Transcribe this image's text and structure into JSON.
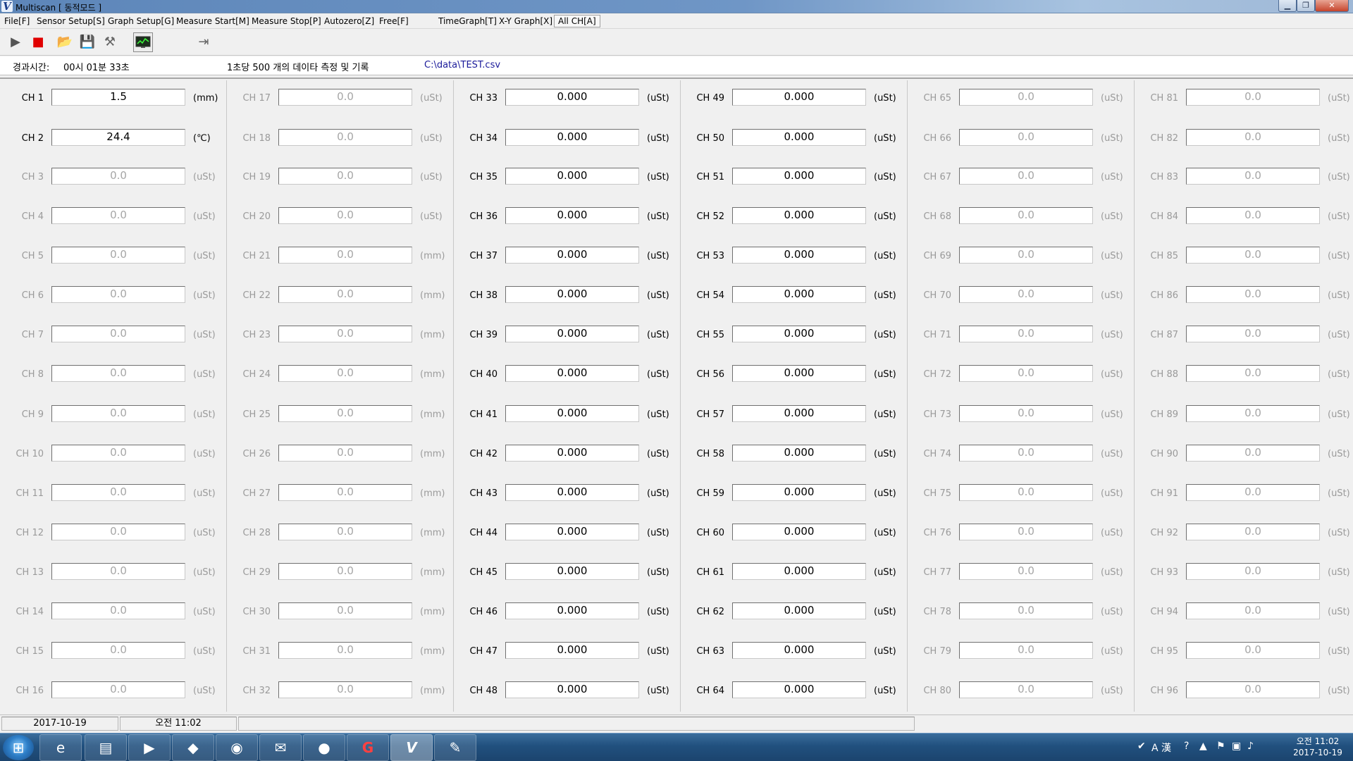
{
  "window": {
    "title": "Multiscan  [ 동적모드 ]"
  },
  "menu": [
    {
      "label": "File[F]",
      "disabled": true
    },
    {
      "label": "Sensor Setup[S]",
      "disabled": true
    },
    {
      "label": "Graph Setup[G]",
      "disabled": false
    },
    {
      "label": "Measure Start[M]",
      "disabled": true
    },
    {
      "label": "Measure Stop[P]",
      "disabled": false
    },
    {
      "label": "Autozero[Z]",
      "disabled": true
    },
    {
      "label": "Free[F]",
      "disabled": true
    },
    {
      "label": "TimeGraph[T]",
      "disabled": false
    },
    {
      "label": "X-Y Graph[X]",
      "disabled": true
    },
    {
      "label": "All CH[A]",
      "disabled": false
    }
  ],
  "toolbar": {
    "icons": [
      "play-icon",
      "stop-icon",
      "open-folder-icon",
      "save-icon",
      "tools-icon",
      "monitor-graph-icon",
      "exit-icon"
    ]
  },
  "info": {
    "elapsed_label": "경과시간:",
    "elapsed_value": "00시 01분 33초",
    "rate_text": "1초당 500 개의 데이타 측정 및 기록",
    "file_path": "C:\\data\\TEST.csv"
  },
  "columns": [
    {
      "channels": [
        {
          "label": "CH 1",
          "value": "1.5",
          "unit": "(mm)",
          "active": true
        },
        {
          "label": "CH 2",
          "value": "24.4",
          "unit": "(℃)",
          "active": true
        },
        {
          "label": "CH 3",
          "value": "0.0",
          "unit": "(uSt)",
          "active": false
        },
        {
          "label": "CH 4",
          "value": "0.0",
          "unit": "(uSt)",
          "active": false
        },
        {
          "label": "CH 5",
          "value": "0.0",
          "unit": "(uSt)",
          "active": false
        },
        {
          "label": "CH 6",
          "value": "0.0",
          "unit": "(uSt)",
          "active": false
        },
        {
          "label": "CH 7",
          "value": "0.0",
          "unit": "(uSt)",
          "active": false
        },
        {
          "label": "CH 8",
          "value": "0.0",
          "unit": "(uSt)",
          "active": false
        },
        {
          "label": "CH 9",
          "value": "0.0",
          "unit": "(uSt)",
          "active": false
        },
        {
          "label": "CH 10",
          "value": "0.0",
          "unit": "(uSt)",
          "active": false
        },
        {
          "label": "CH 11",
          "value": "0.0",
          "unit": "(uSt)",
          "active": false
        },
        {
          "label": "CH 12",
          "value": "0.0",
          "unit": "(uSt)",
          "active": false
        },
        {
          "label": "CH 13",
          "value": "0.0",
          "unit": "(uSt)",
          "active": false
        },
        {
          "label": "CH 14",
          "value": "0.0",
          "unit": "(uSt)",
          "active": false
        },
        {
          "label": "CH 15",
          "value": "0.0",
          "unit": "(uSt)",
          "active": false
        },
        {
          "label": "CH 16",
          "value": "0.0",
          "unit": "(uSt)",
          "active": false
        }
      ]
    },
    {
      "channels": [
        {
          "label": "CH 17",
          "value": "0.0",
          "unit": "(uSt)",
          "active": false
        },
        {
          "label": "CH 18",
          "value": "0.0",
          "unit": "(uSt)",
          "active": false
        },
        {
          "label": "CH 19",
          "value": "0.0",
          "unit": "(uSt)",
          "active": false
        },
        {
          "label": "CH 20",
          "value": "0.0",
          "unit": "(uSt)",
          "active": false
        },
        {
          "label": "CH 21",
          "value": "0.0",
          "unit": "(mm)",
          "active": false
        },
        {
          "label": "CH 22",
          "value": "0.0",
          "unit": "(mm)",
          "active": false
        },
        {
          "label": "CH 23",
          "value": "0.0",
          "unit": "(mm)",
          "active": false
        },
        {
          "label": "CH 24",
          "value": "0.0",
          "unit": "(mm)",
          "active": false
        },
        {
          "label": "CH 25",
          "value": "0.0",
          "unit": "(mm)",
          "active": false
        },
        {
          "label": "CH 26",
          "value": "0.0",
          "unit": "(mm)",
          "active": false
        },
        {
          "label": "CH 27",
          "value": "0.0",
          "unit": "(mm)",
          "active": false
        },
        {
          "label": "CH 28",
          "value": "0.0",
          "unit": "(mm)",
          "active": false
        },
        {
          "label": "CH 29",
          "value": "0.0",
          "unit": "(mm)",
          "active": false
        },
        {
          "label": "CH 30",
          "value": "0.0",
          "unit": "(mm)",
          "active": false
        },
        {
          "label": "CH 31",
          "value": "0.0",
          "unit": "(mm)",
          "active": false
        },
        {
          "label": "CH 32",
          "value": "0.0",
          "unit": "(mm)",
          "active": false
        }
      ]
    },
    {
      "channels": [
        {
          "label": "CH 33",
          "value": "0.000",
          "unit": "(uSt)",
          "active": true
        },
        {
          "label": "CH 34",
          "value": "0.000",
          "unit": "(uSt)",
          "active": true
        },
        {
          "label": "CH 35",
          "value": "0.000",
          "unit": "(uSt)",
          "active": true
        },
        {
          "label": "CH 36",
          "value": "0.000",
          "unit": "(uSt)",
          "active": true
        },
        {
          "label": "CH 37",
          "value": "0.000",
          "unit": "(uSt)",
          "active": true
        },
        {
          "label": "CH 38",
          "value": "0.000",
          "unit": "(uSt)",
          "active": true
        },
        {
          "label": "CH 39",
          "value": "0.000",
          "unit": "(uSt)",
          "active": true
        },
        {
          "label": "CH 40",
          "value": "0.000",
          "unit": "(uSt)",
          "active": true
        },
        {
          "label": "CH 41",
          "value": "0.000",
          "unit": "(uSt)",
          "active": true
        },
        {
          "label": "CH 42",
          "value": "0.000",
          "unit": "(uSt)",
          "active": true
        },
        {
          "label": "CH 43",
          "value": "0.000",
          "unit": "(uSt)",
          "active": true
        },
        {
          "label": "CH 44",
          "value": "0.000",
          "unit": "(uSt)",
          "active": true
        },
        {
          "label": "CH 45",
          "value": "0.000",
          "unit": "(uSt)",
          "active": true
        },
        {
          "label": "CH 46",
          "value": "0.000",
          "unit": "(uSt)",
          "active": true
        },
        {
          "label": "CH 47",
          "value": "0.000",
          "unit": "(uSt)",
          "active": true
        },
        {
          "label": "CH 48",
          "value": "0.000",
          "unit": "(uSt)",
          "active": true
        }
      ]
    },
    {
      "channels": [
        {
          "label": "CH 49",
          "value": "0.000",
          "unit": "(uSt)",
          "active": true
        },
        {
          "label": "CH 50",
          "value": "0.000",
          "unit": "(uSt)",
          "active": true
        },
        {
          "label": "CH 51",
          "value": "0.000",
          "unit": "(uSt)",
          "active": true
        },
        {
          "label": "CH 52",
          "value": "0.000",
          "unit": "(uSt)",
          "active": true
        },
        {
          "label": "CH 53",
          "value": "0.000",
          "unit": "(uSt)",
          "active": true
        },
        {
          "label": "CH 54",
          "value": "0.000",
          "unit": "(uSt)",
          "active": true
        },
        {
          "label": "CH 55",
          "value": "0.000",
          "unit": "(uSt)",
          "active": true
        },
        {
          "label": "CH 56",
          "value": "0.000",
          "unit": "(uSt)",
          "active": true
        },
        {
          "label": "CH 57",
          "value": "0.000",
          "unit": "(uSt)",
          "active": true
        },
        {
          "label": "CH 58",
          "value": "0.000",
          "unit": "(uSt)",
          "active": true
        },
        {
          "label": "CH 59",
          "value": "0.000",
          "unit": "(uSt)",
          "active": true
        },
        {
          "label": "CH 60",
          "value": "0.000",
          "unit": "(uSt)",
          "active": true
        },
        {
          "label": "CH 61",
          "value": "0.000",
          "unit": "(uSt)",
          "active": true
        },
        {
          "label": "CH 62",
          "value": "0.000",
          "unit": "(uSt)",
          "active": true
        },
        {
          "label": "CH 63",
          "value": "0.000",
          "unit": "(uSt)",
          "active": true
        },
        {
          "label": "CH 64",
          "value": "0.000",
          "unit": "(uSt)",
          "active": true
        }
      ]
    },
    {
      "channels": [
        {
          "label": "CH 65",
          "value": "0.0",
          "unit": "(uSt)",
          "active": false
        },
        {
          "label": "CH 66",
          "value": "0.0",
          "unit": "(uSt)",
          "active": false
        },
        {
          "label": "CH 67",
          "value": "0.0",
          "unit": "(uSt)",
          "active": false
        },
        {
          "label": "CH 68",
          "value": "0.0",
          "unit": "(uSt)",
          "active": false
        },
        {
          "label": "CH 69",
          "value": "0.0",
          "unit": "(uSt)",
          "active": false
        },
        {
          "label": "CH 70",
          "value": "0.0",
          "unit": "(uSt)",
          "active": false
        },
        {
          "label": "CH 71",
          "value": "0.0",
          "unit": "(uSt)",
          "active": false
        },
        {
          "label": "CH 72",
          "value": "0.0",
          "unit": "(uSt)",
          "active": false
        },
        {
          "label": "CH 73",
          "value": "0.0",
          "unit": "(uSt)",
          "active": false
        },
        {
          "label": "CH 74",
          "value": "0.0",
          "unit": "(uSt)",
          "active": false
        },
        {
          "label": "CH 75",
          "value": "0.0",
          "unit": "(uSt)",
          "active": false
        },
        {
          "label": "CH 76",
          "value": "0.0",
          "unit": "(uSt)",
          "active": false
        },
        {
          "label": "CH 77",
          "value": "0.0",
          "unit": "(uSt)",
          "active": false
        },
        {
          "label": "CH 78",
          "value": "0.0",
          "unit": "(uSt)",
          "active": false
        },
        {
          "label": "CH 79",
          "value": "0.0",
          "unit": "(uSt)",
          "active": false
        },
        {
          "label": "CH 80",
          "value": "0.0",
          "unit": "(uSt)",
          "active": false
        }
      ]
    },
    {
      "channels": [
        {
          "label": "CH 81",
          "value": "0.0",
          "unit": "(uSt)",
          "active": false
        },
        {
          "label": "CH 82",
          "value": "0.0",
          "unit": "(uSt)",
          "active": false
        },
        {
          "label": "CH 83",
          "value": "0.0",
          "unit": "(uSt)",
          "active": false
        },
        {
          "label": "CH 84",
          "value": "0.0",
          "unit": "(uSt)",
          "active": false
        },
        {
          "label": "CH 85",
          "value": "0.0",
          "unit": "(uSt)",
          "active": false
        },
        {
          "label": "CH 86",
          "value": "0.0",
          "unit": "(uSt)",
          "active": false
        },
        {
          "label": "CH 87",
          "value": "0.0",
          "unit": "(uSt)",
          "active": false
        },
        {
          "label": "CH 88",
          "value": "0.0",
          "unit": "(uSt)",
          "active": false
        },
        {
          "label": "CH 89",
          "value": "0.0",
          "unit": "(uSt)",
          "active": false
        },
        {
          "label": "CH 90",
          "value": "0.0",
          "unit": "(uSt)",
          "active": false
        },
        {
          "label": "CH 91",
          "value": "0.0",
          "unit": "(uSt)",
          "active": false
        },
        {
          "label": "CH 92",
          "value": "0.0",
          "unit": "(uSt)",
          "active": false
        },
        {
          "label": "CH 93",
          "value": "0.0",
          "unit": "(uSt)",
          "active": false
        },
        {
          "label": "CH 94",
          "value": "0.0",
          "unit": "(uSt)",
          "active": false
        },
        {
          "label": "CH 95",
          "value": "0.0",
          "unit": "(uSt)",
          "active": false
        },
        {
          "label": "CH 96",
          "value": "0.0",
          "unit": "(uSt)",
          "active": false
        }
      ]
    }
  ],
  "statusbar": {
    "date": "2017-10-19",
    "time": "오전 11:02"
  },
  "taskbar": {
    "apps": [
      "internet-explorer-icon",
      "file-explorer-icon",
      "media-player-icon",
      "app-icon",
      "chrome-icon",
      "outlook-icon",
      "green-app-icon",
      "go-app-icon",
      "multiscan-app-icon",
      "paint-icon"
    ],
    "tray_text": "A 漢",
    "clock_time": "오전 11:02",
    "clock_date": "2017-10-19"
  }
}
